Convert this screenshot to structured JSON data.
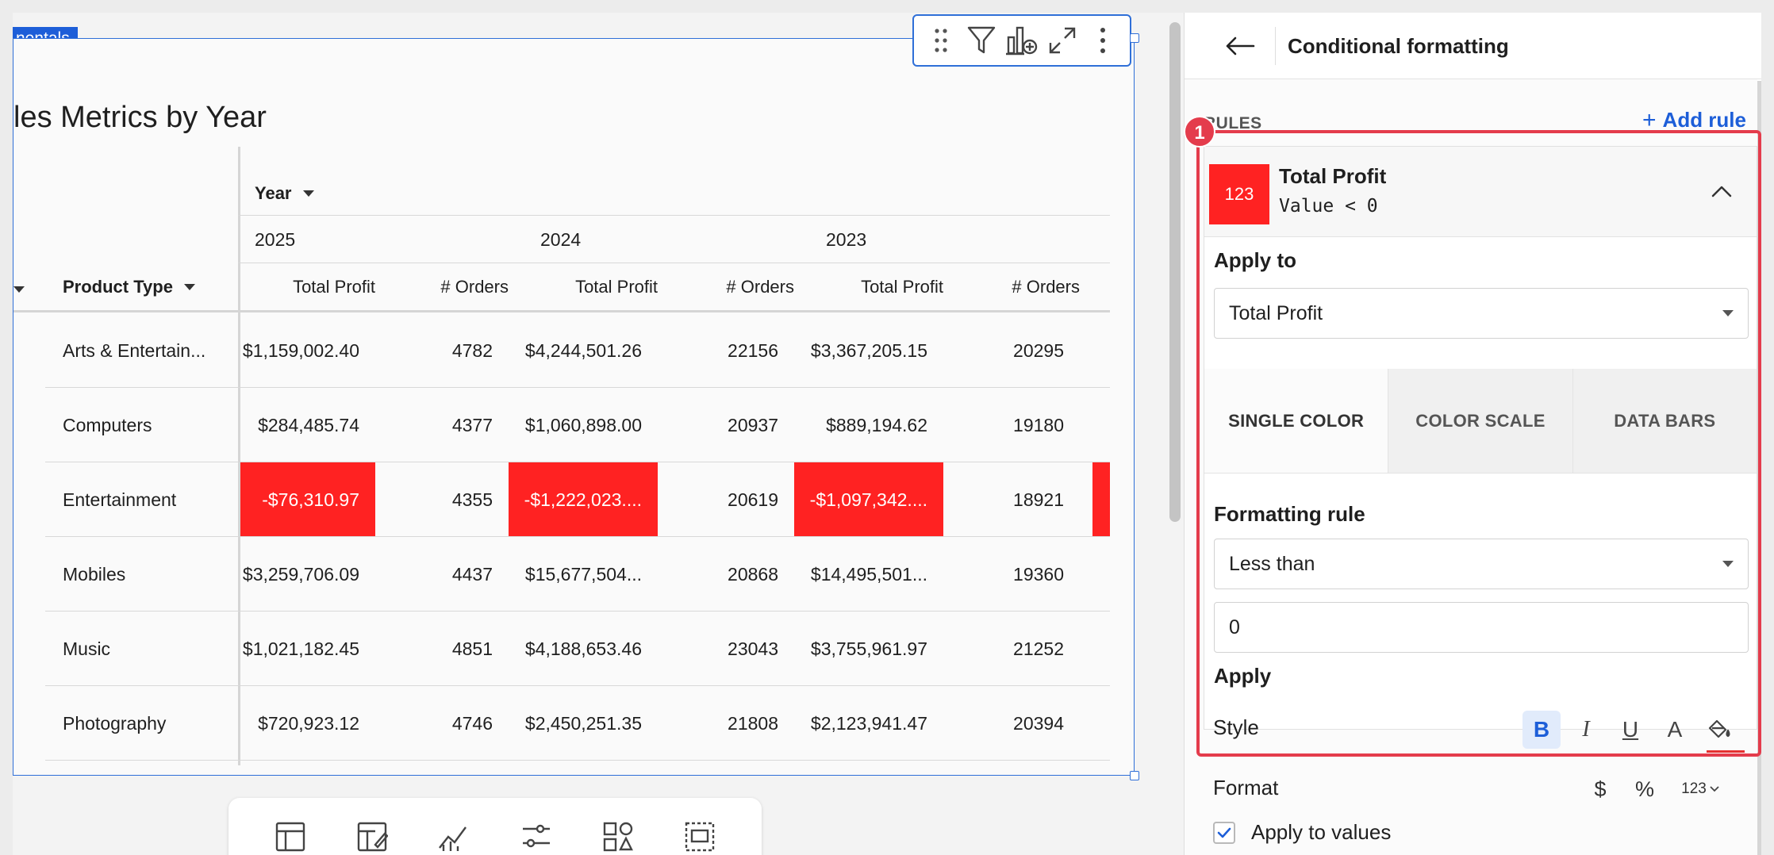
{
  "canvas": {
    "element_tag": "nentals",
    "viz_title": "les Metrics by Year"
  },
  "pivot": {
    "column_header_label": "Year",
    "row_header_label": "Product Type",
    "years": [
      "2025",
      "2024",
      "2023"
    ],
    "measure_headers": [
      "Total Profit",
      "# Orders",
      "Total Profit",
      "# Orders",
      "Total Profit",
      "# Orders"
    ],
    "rows": [
      {
        "name": "Arts & Entertain...",
        "cells": [
          "$1,159,002.40",
          "4782",
          "$4,244,501.26",
          "22156",
          "$3,367,205.15",
          "20295"
        ],
        "neg": [
          false,
          false,
          false,
          false,
          false,
          false
        ],
        "tail_neg": false
      },
      {
        "name": "Computers",
        "cells": [
          "$284,485.74",
          "4377",
          "$1,060,898.00",
          "20937",
          "$889,194.62",
          "19180"
        ],
        "neg": [
          false,
          false,
          false,
          false,
          false,
          false
        ],
        "tail_neg": false
      },
      {
        "name": "Entertainment",
        "cells": [
          "-$76,310.97",
          "4355",
          "-$1,222,023....",
          "20619",
          "-$1,097,342....",
          "18921"
        ],
        "neg": [
          true,
          false,
          true,
          false,
          true,
          false
        ],
        "tail_neg": true
      },
      {
        "name": "Mobiles",
        "cells": [
          "$3,259,706.09",
          "4437",
          "$15,677,504...",
          "20868",
          "$14,495,501...",
          "19360"
        ],
        "neg": [
          false,
          false,
          false,
          false,
          false,
          false
        ],
        "tail_neg": false
      },
      {
        "name": "Music",
        "cells": [
          "$1,021,182.45",
          "4851",
          "$4,188,653.46",
          "23043",
          "$3,755,961.97",
          "21252"
        ],
        "neg": [
          false,
          false,
          false,
          false,
          false,
          false
        ],
        "tail_neg": false
      },
      {
        "name": "Photography",
        "cells": [
          "$720,923.12",
          "4746",
          "$2,450,251.35",
          "21808",
          "$2,123,941.47",
          "20394"
        ],
        "neg": [
          false,
          false,
          false,
          false,
          false,
          false
        ],
        "tail_neg": false
      }
    ]
  },
  "panel": {
    "title": "Conditional formatting",
    "rules_label": "RULES",
    "add_rule_label": "Add rule",
    "rule": {
      "swatch_text": "123",
      "swatch_color": "#ff2222",
      "title": "Total Profit",
      "condition": "Value < 0"
    },
    "apply_to_label": "Apply to",
    "apply_to_value": "Total Profit",
    "tabs": [
      "SINGLE COLOR",
      "COLOR SCALE",
      "DATA BARS"
    ],
    "active_tab": "SINGLE COLOR",
    "formatting_rule_label": "Formatting rule",
    "formatting_rule_value": "Less than",
    "threshold_value": "0",
    "apply_label": "Apply",
    "style_label": "Style",
    "style_buttons": {
      "bold": "B",
      "italic": "I",
      "underline": "U",
      "text_color": "A"
    },
    "format_label": "Format",
    "format_buttons": {
      "currency": "$",
      "percent": "%",
      "number": "123"
    },
    "apply_to_values_label": "Apply to values",
    "badge": "1"
  },
  "colors": {
    "accent": "#1d5ed8",
    "negative_fill": "#ff2222",
    "highlight": "#e43c4c"
  }
}
